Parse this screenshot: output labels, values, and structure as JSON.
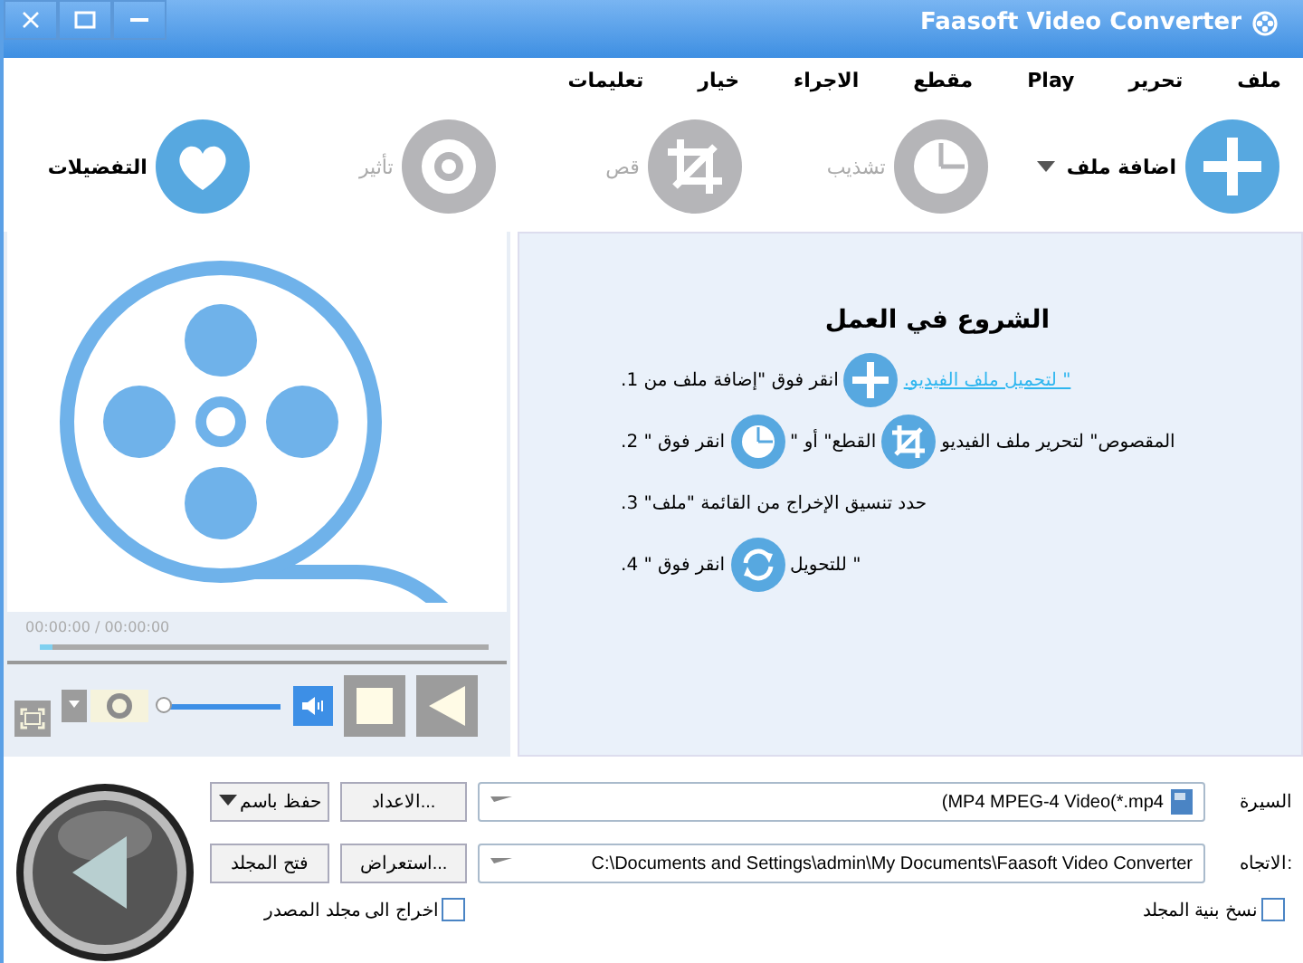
{
  "window": {
    "title": "Faasoft Video Converter"
  },
  "menu": [
    "ملف",
    "تحرير",
    "Play",
    "مقطع",
    "الاجراء",
    "خيار",
    "تعليمات"
  ],
  "toolbar": [
    {
      "label": "اضافة ملف",
      "disabled": false,
      "dropdown": true
    },
    {
      "label": "تشذيب",
      "disabled": true,
      "dropdown": false
    },
    {
      "label": "قص",
      "disabled": true,
      "dropdown": false
    },
    {
      "label": "تأثير",
      "disabled": true,
      "dropdown": false
    },
    {
      "label": "التفضيلات",
      "disabled": false,
      "dropdown": false
    }
  ],
  "preview": {
    "time": "00:00:00 / 00:00:00",
    "progress": {
      "level": 0.03
    },
    "volume": {
      "level": 0.0
    }
  },
  "guide": {
    "title": "الشروع في العمل",
    "steps": [
      [
        {
          "kind": "link",
          "text": "\" لتحميل ملف الفيديو."
        },
        {
          "kind": "icon"
        },
        {
          "kind": "text",
          "text": "انقر فوق \"إضافة ملف من 1."
        }
      ],
      [
        {
          "kind": "text",
          "text": "المقصوص\" لتحرير ملف الفيديو"
        },
        {
          "kind": "icon"
        },
        {
          "kind": "text",
          "text": "القطع\" أو \""
        },
        {
          "kind": "icon"
        },
        {
          "kind": "text",
          "text": "انقر فوق \" 2."
        }
      ],
      [
        {
          "kind": "text",
          "text": "حدد تنسيق الإخراج من القائمة \"ملف\" 3."
        }
      ],
      [
        {
          "kind": "text",
          "text": "\" للتحويل"
        },
        {
          "kind": "icon"
        },
        {
          "kind": "text",
          "text": "انقر فوق \" 4."
        }
      ]
    ]
  },
  "output": {
    "profile_label": "السيرة",
    "profile": "(MP4 MPEG-4 Video(*.mp4",
    "settings_button": "الاعداد...",
    "save_as_button": "حفظ باسم",
    "dest_label": "الاتجاه:",
    "dest": "C:\\Documents and Settings\\admin\\My Documents\\Faasoft Video Converter",
    "browse_button": "استعراض...",
    "open_folder_button": "فتح المجلد",
    "options": [
      {
        "label": "نسخ بنية المجلد",
        "checked": false
      },
      {
        "label": "اخراج الى مجلد المصدر",
        "checked": false
      }
    ]
  }
}
